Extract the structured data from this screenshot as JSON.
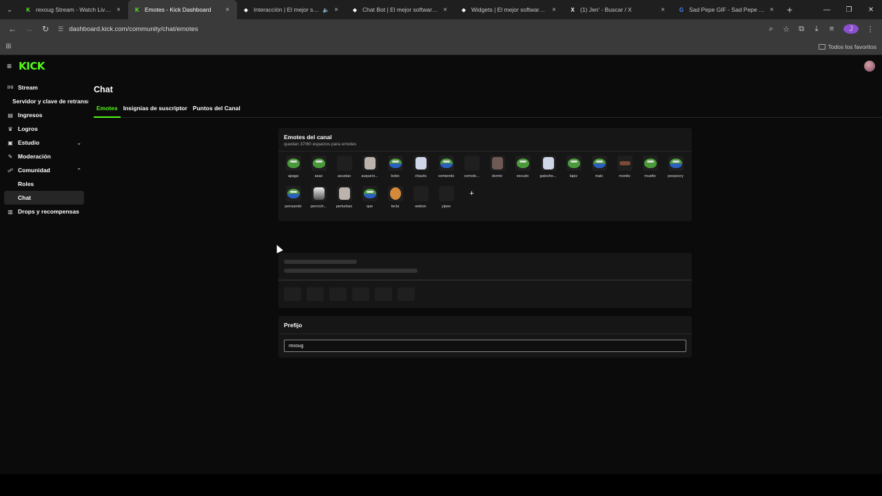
{
  "browser": {
    "tabs": [
      {
        "title": "rexoug Stream - Watch Live on",
        "icon": "kick-icon",
        "active": false
      },
      {
        "title": "Emotes - Kick Dashboard",
        "icon": "kick-icon",
        "active": true
      },
      {
        "title": "Interacción | El mejor softw",
        "icon": "diamond-icon",
        "active": false,
        "audio": true
      },
      {
        "title": "Chat Bot | El mejor software pa",
        "icon": "diamond-icon",
        "active": false
      },
      {
        "title": "Widgets | El mejor software pa",
        "icon": "diamond-icon",
        "active": false
      },
      {
        "title": "(1) Jen' - Buscar / X",
        "icon": "x-icon",
        "active": false
      },
      {
        "title": "Sad Pepe GIF - Sad Pepe Peepo",
        "icon": "gif-icon",
        "active": false
      }
    ],
    "url": "dashboard.kick.com/community/chat/emotes",
    "profile_initial": "J",
    "bookmarks_all": "Todos los favoritos"
  },
  "app": {
    "logo": "KICK",
    "accent": "#53fc18",
    "sidebar": [
      {
        "label": "Stream",
        "icon": "broadcast-icon",
        "type": "item"
      },
      {
        "label": "Servidor y clave de retransmisión",
        "type": "sub-plain"
      },
      {
        "label": "Ingresos",
        "icon": "wallet-icon",
        "type": "item"
      },
      {
        "label": "Logros",
        "icon": "trophy-icon",
        "type": "item"
      },
      {
        "label": "Estudio",
        "icon": "studio-icon",
        "type": "item",
        "chevron": "down"
      },
      {
        "label": "Moderación",
        "icon": "pencil-icon",
        "type": "item"
      },
      {
        "label": "Comunidad",
        "icon": "users-icon",
        "type": "item",
        "chevron": "up"
      },
      {
        "label": "Roles",
        "type": "sub"
      },
      {
        "label": "Chat",
        "type": "sub",
        "active": true
      },
      {
        "label": "Drops y recompensas",
        "icon": "gift-icon",
        "type": "item"
      }
    ],
    "page_title": "Chat",
    "tabs": [
      "Emotes",
      "Insignias de suscriptor",
      "Puntos del Canal"
    ],
    "emotes_panel": {
      "title": "Emotes del canal",
      "subtitle": "quedan 37/60 espacios para emotes",
      "emotes": [
        {
          "name": "apaga",
          "img": "pepe"
        },
        {
          "name": "asao",
          "img": "pepe"
        },
        {
          "name": "asustao",
          "img": "blank"
        },
        {
          "name": "auqueni...",
          "img": "face"
        },
        {
          "name": "bobo",
          "img": "pepe-blue"
        },
        {
          "name": "chaufa",
          "img": "face-light"
        },
        {
          "name": "comiendo",
          "img": "pepe-blue"
        },
        {
          "name": "comolo...",
          "img": "blank"
        },
        {
          "name": "dormir",
          "img": "face-dark"
        },
        {
          "name": "escudo",
          "img": "pepe"
        },
        {
          "name": "gatosho...",
          "img": "face-light"
        },
        {
          "name": "lapiz",
          "img": "pepe"
        },
        {
          "name": "malo",
          "img": "pepe-blue"
        },
        {
          "name": "monito",
          "img": "face-brown"
        },
        {
          "name": "muelto",
          "img": "pepe"
        },
        {
          "name": "peepocry",
          "img": "pepe-blue"
        },
        {
          "name": "pensando",
          "img": "pepe-blue"
        },
        {
          "name": "perroch...",
          "img": "face-bw"
        },
        {
          "name": "perturbao",
          "img": "face"
        },
        {
          "name": "que",
          "img": "pepe-blue"
        },
        {
          "name": "tecla",
          "img": "face-orange"
        },
        {
          "name": "webon",
          "img": "blank"
        },
        {
          "name": "yipee",
          "img": "blank"
        }
      ],
      "add_label": "+"
    },
    "prefix_panel": {
      "title": "Prefijo",
      "value": "rexoug"
    }
  }
}
